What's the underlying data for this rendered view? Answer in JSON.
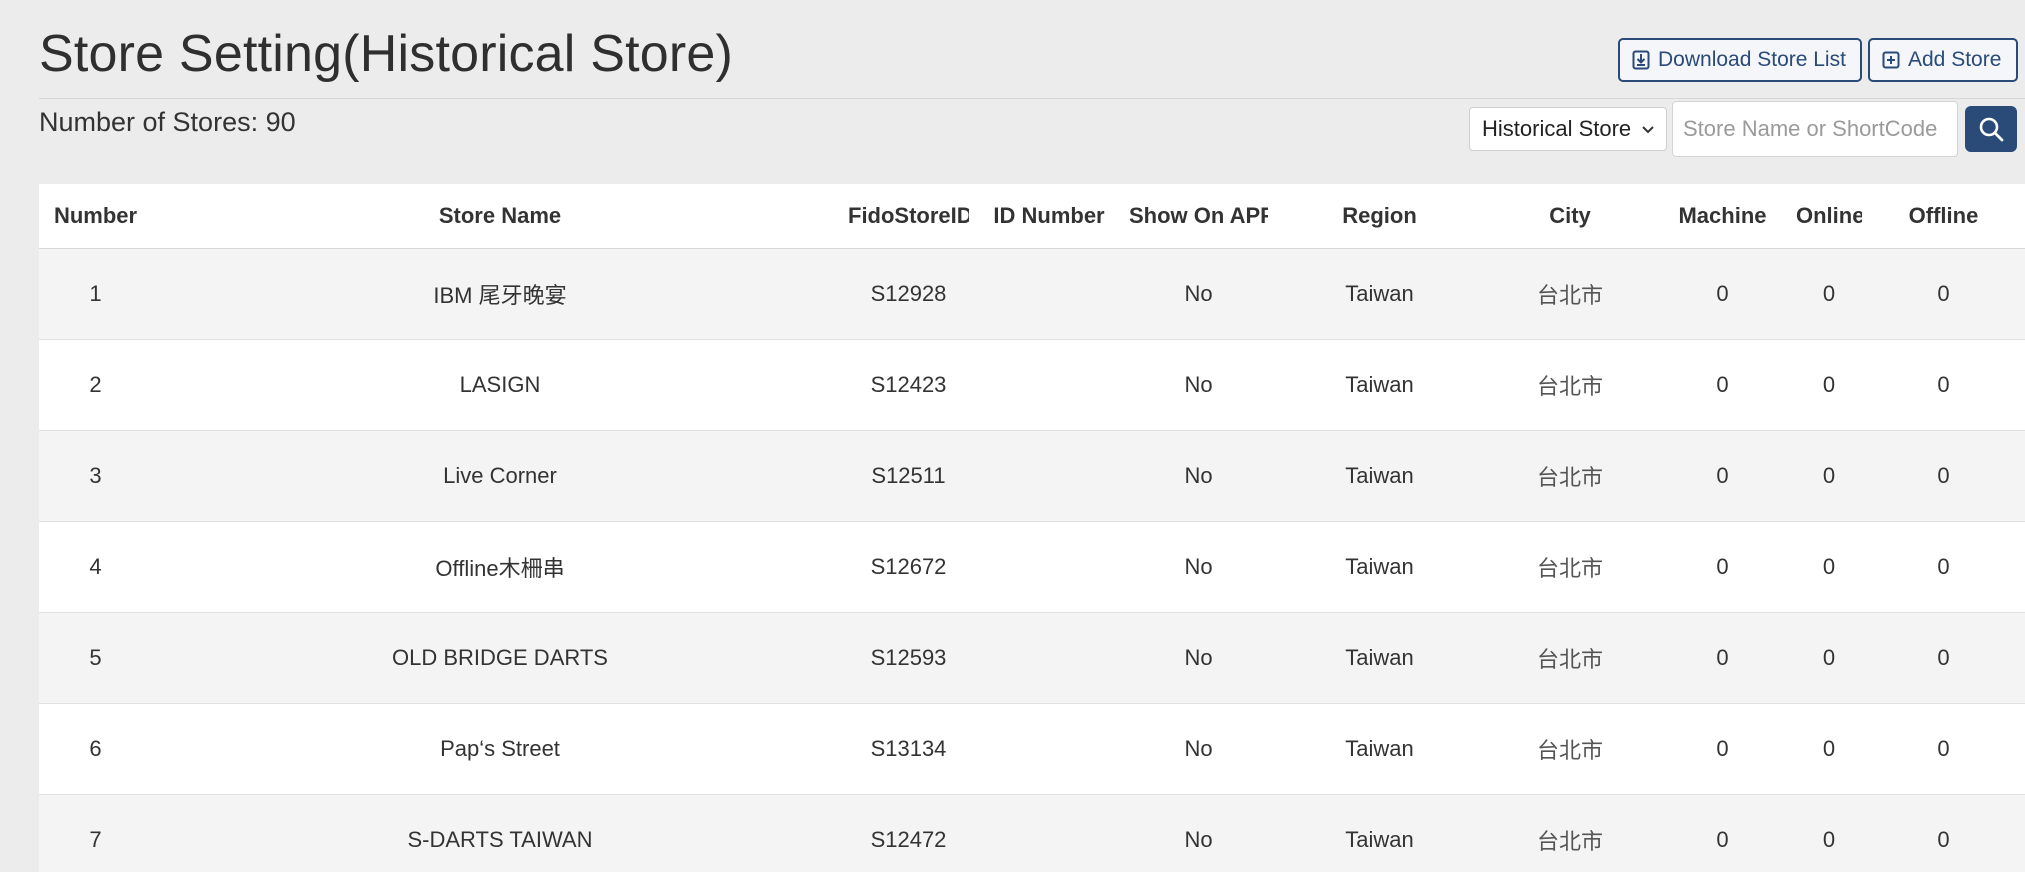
{
  "header": {
    "title": "Store Setting(Historical Store)",
    "store_count_label": "Number of Stores: 90",
    "download_label": "Download Store List",
    "add_label": "Add Store"
  },
  "filters": {
    "selected": "Historical Store",
    "search_placeholder": "Store Name or ShortCode",
    "search_value": ""
  },
  "table": {
    "columns": [
      "Number",
      "Store Name",
      "FidoStoreID",
      "ID Number",
      "Show On APP",
      "Region",
      "City",
      "Machine",
      "Online",
      "Offline"
    ],
    "rows": [
      {
        "number": "1",
        "name": "IBM 尾牙晚宴",
        "fido_id": "S12928",
        "id_number": "",
        "show_on_app": "No",
        "region": "Taiwan",
        "city": "台北市",
        "machine": "0",
        "online": "0",
        "offline": "0"
      },
      {
        "number": "2",
        "name": "LASIGN",
        "fido_id": "S12423",
        "id_number": "",
        "show_on_app": "No",
        "region": "Taiwan",
        "city": "台北市",
        "machine": "0",
        "online": "0",
        "offline": "0"
      },
      {
        "number": "3",
        "name": "Live Corner",
        "fido_id": "S12511",
        "id_number": "",
        "show_on_app": "No",
        "region": "Taiwan",
        "city": "台北市",
        "machine": "0",
        "online": "0",
        "offline": "0"
      },
      {
        "number": "4",
        "name": "Offline木柵串",
        "fido_id": "S12672",
        "id_number": "",
        "show_on_app": "No",
        "region": "Taiwan",
        "city": "台北市",
        "machine": "0",
        "online": "0",
        "offline": "0"
      },
      {
        "number": "5",
        "name": "OLD BRIDGE DARTS",
        "fido_id": "S12593",
        "id_number": "",
        "show_on_app": "No",
        "region": "Taiwan",
        "city": "台北市",
        "machine": "0",
        "online": "0",
        "offline": "0"
      },
      {
        "number": "6",
        "name": "Pap‘s Street",
        "fido_id": "S13134",
        "id_number": "",
        "show_on_app": "No",
        "region": "Taiwan",
        "city": "台北市",
        "machine": "0",
        "online": "0",
        "offline": "0"
      },
      {
        "number": "7",
        "name": "S-DARTS TAIWAN",
        "fido_id": "S12472",
        "id_number": "",
        "show_on_app": "No",
        "region": "Taiwan",
        "city": "台北市",
        "machine": "0",
        "online": "0",
        "offline": "0"
      }
    ]
  },
  "colors": {
    "accent": "#2a4a78",
    "background": "#ececec"
  }
}
